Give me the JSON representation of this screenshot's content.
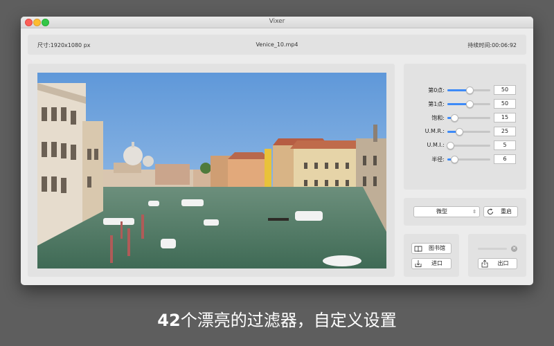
{
  "window": {
    "title": "Vixer"
  },
  "info_bar": {
    "dimensions": "尺寸:1920x1080 px",
    "filename": "Venice_10.mp4",
    "duration": "持续时间:00:06:92"
  },
  "sliders": [
    {
      "label": "第0点:",
      "value": "50",
      "level": 0.5
    },
    {
      "label": "第1点:",
      "value": "50",
      "level": 0.5
    },
    {
      "label": "饱和:",
      "value": "15",
      "level": 0.15
    },
    {
      "label": "U.M.R.:",
      "value": "25",
      "level": 0.25
    },
    {
      "label": "U.M.I.:",
      "value": "5",
      "level": 0.05
    },
    {
      "label": "半径:",
      "value": "6",
      "level": 0.15
    }
  ],
  "preset": {
    "selected": "微型",
    "reset_label": "重启"
  },
  "library": {
    "library_label": "图书馆",
    "import_label": "进口"
  },
  "export": {
    "progress": 0,
    "export_label": "出口"
  },
  "caption": {
    "number": "42",
    "text": "个漂亮的过滤器，自定义设置"
  },
  "icons": {
    "reset": "reload-icon",
    "library": "book-icon",
    "import": "import-tray-icon",
    "export": "share-icon",
    "cancel": "close-circle-icon"
  },
  "colors": {
    "accent": "#3d8af7",
    "close": "#fc5f57",
    "minimize": "#fdbc2e",
    "maximize": "#33c748"
  }
}
